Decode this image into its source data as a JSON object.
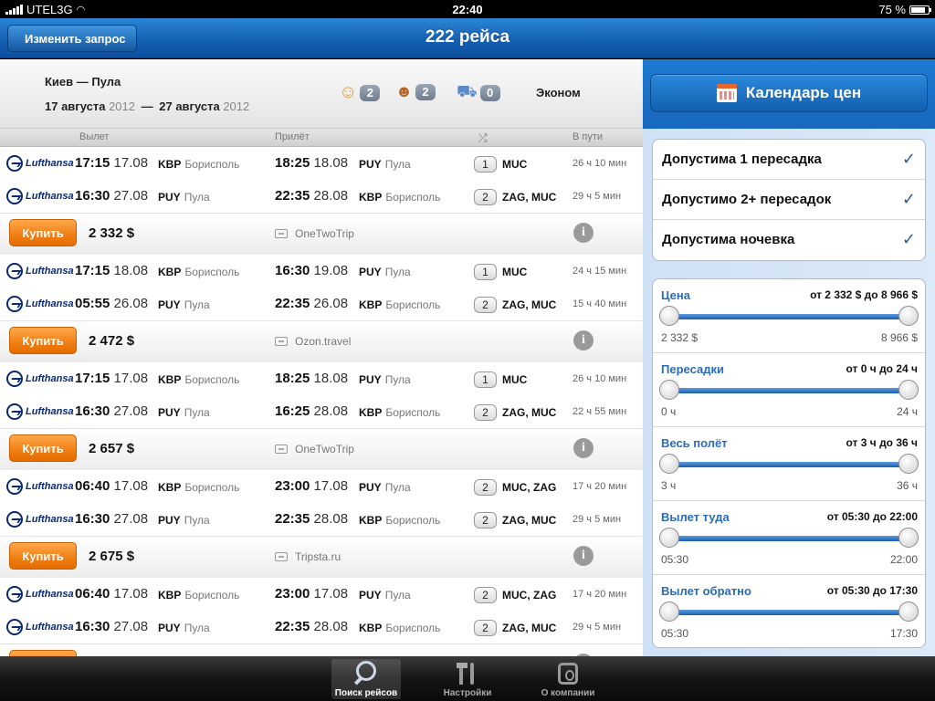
{
  "status_bar": {
    "carrier": "UTEL3G",
    "time": "22:40",
    "battery": "75 %"
  },
  "nav": {
    "back_label": "Изменить запрос",
    "title": "222 рейса"
  },
  "summary": {
    "route": "Киев — Пула",
    "depart_date": "17 августа",
    "depart_year": "2012",
    "dash": "—",
    "return_date": "27 августа",
    "return_year": "2012",
    "adults": "2",
    "children": "2",
    "infants": "0",
    "class": "Эконом"
  },
  "columns": {
    "depart": "Вылет",
    "arrive": "Прилёт",
    "duration": "В пути"
  },
  "results": [
    {
      "segments": [
        {
          "airline": "Lufthansa",
          "dep_time": "17:15",
          "dep_date": "17.08",
          "dep_code": "KBP",
          "dep_city": "Борисполь",
          "arr_time": "18:25",
          "arr_date": "18.08",
          "arr_code": "PUY",
          "arr_city": "Пула",
          "stops": "1",
          "via": "MUC",
          "duration": "26 ч 10 мин"
        },
        {
          "airline": "Lufthansa",
          "dep_time": "16:30",
          "dep_date": "27.08",
          "dep_code": "PUY",
          "dep_city": "Пула",
          "arr_time": "22:35",
          "arr_date": "28.08",
          "arr_code": "KBP",
          "arr_city": "Борисполь",
          "stops": "2",
          "via": "ZAG, MUC",
          "duration": "29 ч 5 мин"
        }
      ],
      "buy_label": "Купить",
      "price": "2 332 $",
      "agency": "OneTwoTrip"
    },
    {
      "segments": [
        {
          "airline": "Lufthansa",
          "dep_time": "17:15",
          "dep_date": "18.08",
          "dep_code": "KBP",
          "dep_city": "Борисполь",
          "arr_time": "16:30",
          "arr_date": "19.08",
          "arr_code": "PUY",
          "arr_city": "Пула",
          "stops": "1",
          "via": "MUC",
          "duration": "24 ч 15 мин"
        },
        {
          "airline": "Lufthansa",
          "dep_time": "05:55",
          "dep_date": "26.08",
          "dep_code": "PUY",
          "dep_city": "Пула",
          "arr_time": "22:35",
          "arr_date": "26.08",
          "arr_code": "KBP",
          "arr_city": "Борисполь",
          "stops": "2",
          "via": "ZAG, MUC",
          "duration": "15 ч 40 мин"
        }
      ],
      "buy_label": "Купить",
      "price": "2 472 $",
      "agency": "Ozon.travel"
    },
    {
      "segments": [
        {
          "airline": "Lufthansa",
          "dep_time": "17:15",
          "dep_date": "17.08",
          "dep_code": "KBP",
          "dep_city": "Борисполь",
          "arr_time": "18:25",
          "arr_date": "18.08",
          "arr_code": "PUY",
          "arr_city": "Пула",
          "stops": "1",
          "via": "MUC",
          "duration": "26 ч 10 мин"
        },
        {
          "airline": "Lufthansa",
          "dep_time": "16:30",
          "dep_date": "27.08",
          "dep_code": "PUY",
          "dep_city": "Пула",
          "arr_time": "16:25",
          "arr_date": "28.08",
          "arr_code": "KBP",
          "arr_city": "Борисполь",
          "stops": "2",
          "via": "ZAG, MUC",
          "duration": "22 ч 55 мин"
        }
      ],
      "buy_label": "Купить",
      "price": "2 657 $",
      "agency": "OneTwoTrip"
    },
    {
      "segments": [
        {
          "airline": "Lufthansa",
          "dep_time": "06:40",
          "dep_date": "17.08",
          "dep_code": "KBP",
          "dep_city": "Борисполь",
          "arr_time": "23:00",
          "arr_date": "17.08",
          "arr_code": "PUY",
          "arr_city": "Пула",
          "stops": "2",
          "via": "MUC, ZAG",
          "duration": "17 ч 20 мин"
        },
        {
          "airline": "Lufthansa",
          "dep_time": "16:30",
          "dep_date": "27.08",
          "dep_code": "PUY",
          "dep_city": "Пула",
          "arr_time": "22:35",
          "arr_date": "28.08",
          "arr_code": "KBP",
          "arr_city": "Борисполь",
          "stops": "2",
          "via": "ZAG, MUC",
          "duration": "29 ч 5 мин"
        }
      ],
      "buy_label": "Купить",
      "price": "2 675 $",
      "agency": "Tripsta.ru"
    },
    {
      "segments": [
        {
          "airline": "Lufthansa",
          "dep_time": "06:40",
          "dep_date": "17.08",
          "dep_code": "KBP",
          "dep_city": "Борисполь",
          "arr_time": "23:00",
          "arr_date": "17.08",
          "arr_code": "PUY",
          "arr_city": "Пула",
          "stops": "2",
          "via": "MUC, ZAG",
          "duration": "17 ч 20 мин"
        },
        {
          "airline": "Lufthansa",
          "dep_time": "16:30",
          "dep_date": "27.08",
          "dep_code": "PUY",
          "dep_city": "Пула",
          "arr_time": "22:35",
          "arr_date": "28.08",
          "arr_code": "KBP",
          "arr_city": "Борисполь",
          "stops": "2",
          "via": "ZAG, MUC",
          "duration": "29 ч 5 мин"
        }
      ],
      "buy_label": "Купить",
      "price": "",
      "agency": ""
    }
  ],
  "sidebar": {
    "calendar_label": "Календарь цен",
    "options": [
      {
        "label": "Допустима 1 пересадка",
        "checked": "✓"
      },
      {
        "label": "Допустимо 2+ пересадок",
        "checked": "✓"
      },
      {
        "label": "Допустима ночевка",
        "checked": "✓"
      }
    ],
    "filters": [
      {
        "name": "Цена",
        "range": "от 2 332 $ до 8 966 $",
        "min": "2 332 $",
        "max": "8 966 $",
        "low_fraction": 0,
        "high_fraction": 1
      },
      {
        "name": "Пересадки",
        "range": "от 0 ч до 24 ч",
        "min": "0 ч",
        "max": "24 ч",
        "low_fraction": 0,
        "high_fraction": 1
      },
      {
        "name": "Весь полёт",
        "range": "от 3 ч до 36 ч",
        "min": "3 ч",
        "max": "36 ч",
        "low_fraction": 0,
        "high_fraction": 1
      },
      {
        "name": "Вылет туда",
        "range": "от 05:30 до 22:00",
        "min": "05:30",
        "max": "22:00",
        "low_fraction": 0,
        "high_fraction": 1
      },
      {
        "name": "Вылет обратно",
        "range": "от 05:30 до 17:30",
        "min": "05:30",
        "max": "17:30",
        "low_fraction": 0,
        "high_fraction": 1
      }
    ]
  },
  "tabs": [
    {
      "label": "Поиск рейсов",
      "active": true
    },
    {
      "label": "Настройки",
      "active": false
    },
    {
      "label": "О компании",
      "active": false
    }
  ],
  "colors": {
    "nav_blue": "#1461b3",
    "buy_orange": "#f07d12",
    "filter_label_blue": "#2a6cb6"
  }
}
